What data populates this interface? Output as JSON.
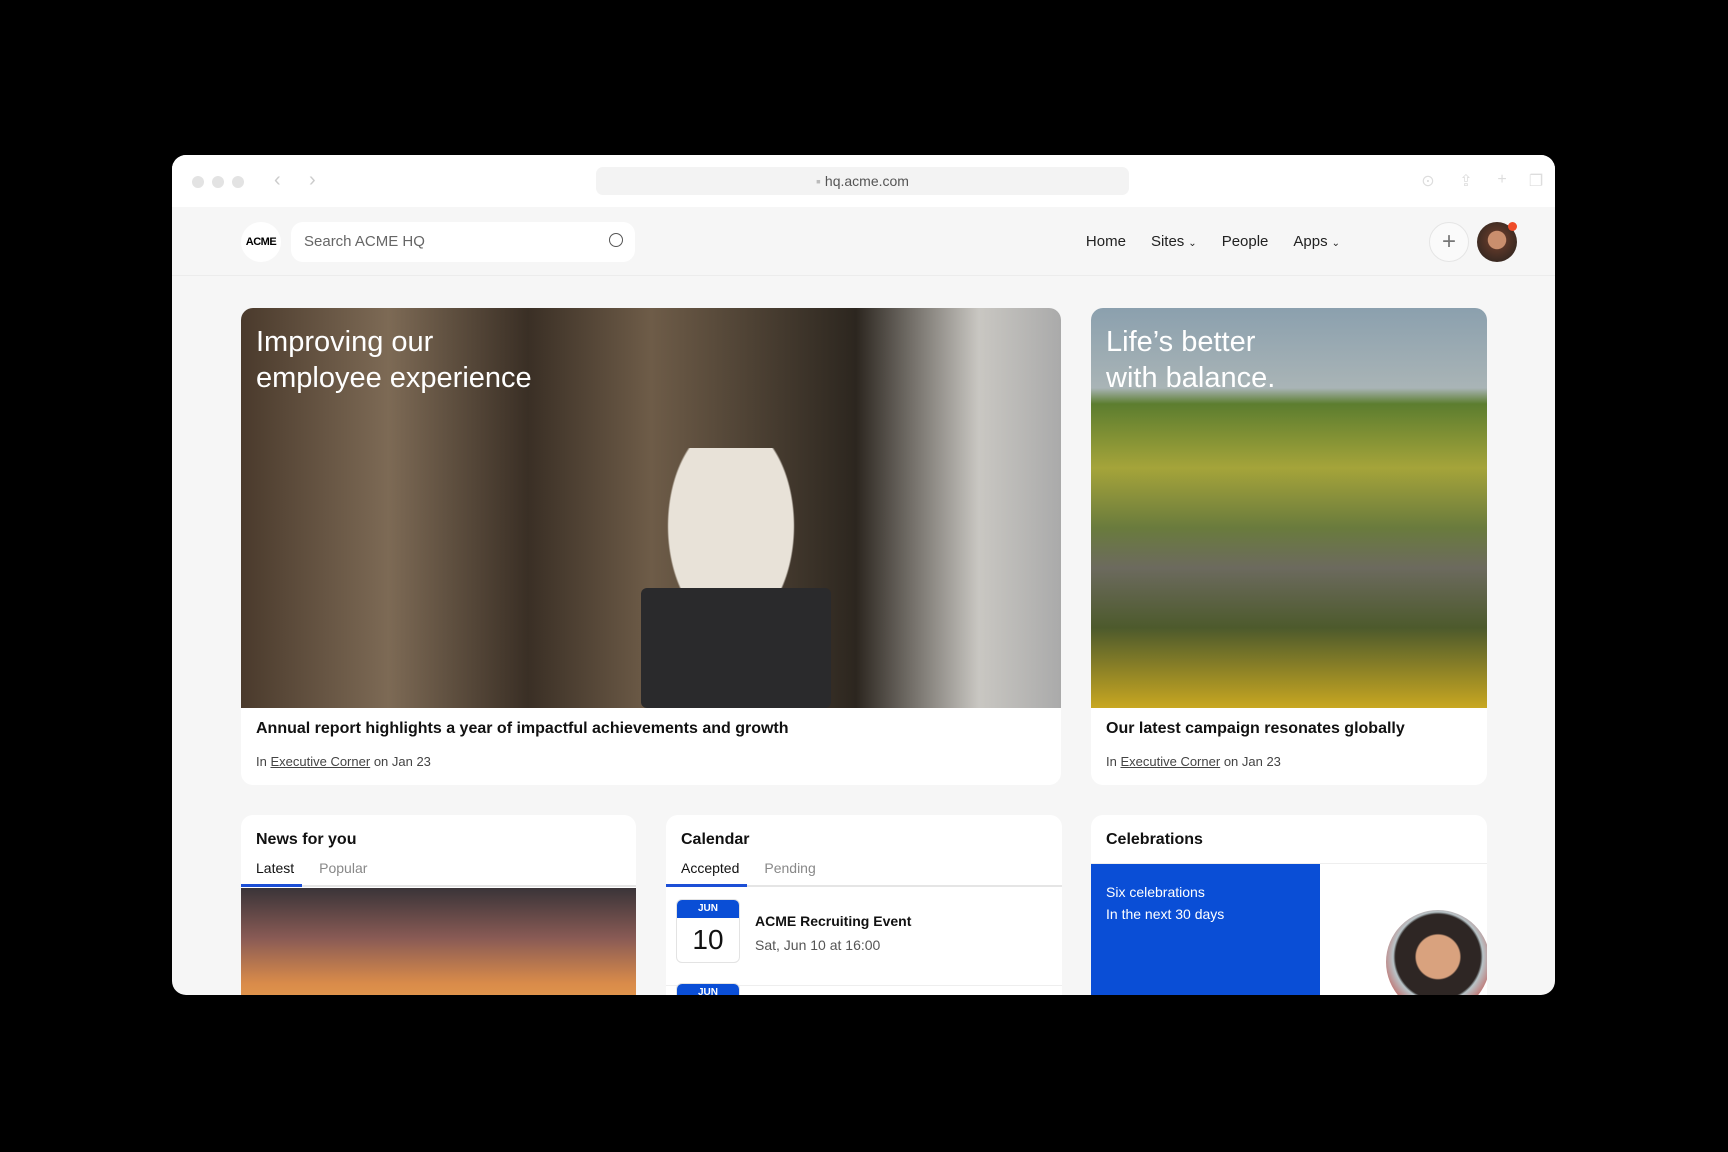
{
  "browser": {
    "url": "hq.acme.com"
  },
  "header": {
    "logo": "ACME",
    "search_placeholder": "Search ACME HQ",
    "nav": [
      "Home",
      "Sites",
      "People",
      "Apps"
    ]
  },
  "hero": [
    {
      "title_line1": "Improving our",
      "title_line2": "employee experience",
      "headline": "Annual report highlights a year of impactful achievements and growth",
      "meta_prefix": "In",
      "meta_link": "Executive Corner",
      "meta_suffix": "on Jan 23"
    },
    {
      "title_line1": "Life’s better",
      "title_line2": "with balance.",
      "headline": "Our latest campaign resonates globally",
      "meta_prefix": "In",
      "meta_link": "Executive Corner",
      "meta_suffix": "on Jan 23"
    }
  ],
  "news": {
    "title": "News for you",
    "tabs": [
      "Latest",
      "Popular"
    ]
  },
  "calendar": {
    "title": "Calendar",
    "tabs": [
      "Accepted",
      "Pending"
    ],
    "events": [
      {
        "month": "JUN",
        "day": "10",
        "name": "ACME Recruiting Event",
        "when": "Sat, Jun 10 at 16:00"
      },
      {
        "month": "JUN"
      }
    ]
  },
  "celebrations": {
    "title": "Celebrations",
    "line1": "Six celebrations",
    "line2": "In the next 30 days"
  },
  "colors": {
    "accent": "#0a4ed6",
    "notification": "#ef4b28"
  }
}
